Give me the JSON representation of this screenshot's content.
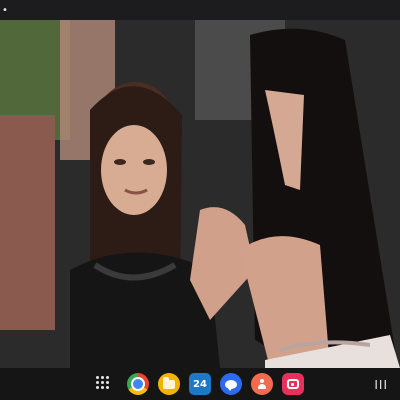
{
  "status_bar": {
    "indicator": "•"
  },
  "video": {
    "scene": "video-frame"
  },
  "taskbar": {
    "apps": [
      {
        "name": "chrome-icon"
      },
      {
        "name": "files-icon"
      },
      {
        "name": "calendar-icon",
        "label": "24"
      },
      {
        "name": "messages-icon"
      },
      {
        "name": "contacts-icon"
      },
      {
        "name": "gallery-icon"
      }
    ],
    "recents_label": "III"
  },
  "colors": {
    "taskbar": "#151515",
    "status_bar": "#1c1c1e"
  }
}
